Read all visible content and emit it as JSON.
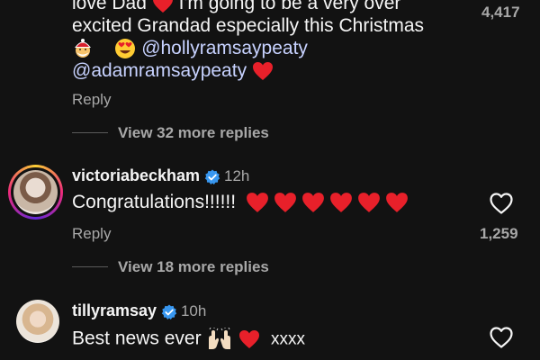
{
  "comment_top": {
    "line1": "love Dad",
    "line1_after": "I'm going to be a very over",
    "line2": "excited Grandad especially this Christmas",
    "mention1": "@hollyramsaypeaty",
    "mention2": "@adamramsaypeaty",
    "like_count": "4,417",
    "reply_label": "Reply",
    "view_more": "View 32 more replies"
  },
  "comment_victoria": {
    "username": "victoriabeckham",
    "time": "12h",
    "text": "Congratulations!!!!!!",
    "heart_count": 6,
    "like_count": "1,259",
    "reply_label": "Reply",
    "view_more": "View 18 more replies"
  },
  "comment_tilly": {
    "username": "tillyramsay",
    "time": "10h",
    "text": "Best news ever",
    "suffix": "xxxx"
  },
  "colors": {
    "background": "#121212",
    "mention": "#c7d2ff",
    "heart_red": "#e8202a",
    "verified_blue": "#3897f0",
    "secondary_text": "#a8a8a8"
  },
  "icons": [
    "red-heart-emoji",
    "santa-emoji",
    "heart-eyes-emoji",
    "raising-hands-emoji",
    "verified-badge-icon",
    "like-heart-icon"
  ]
}
